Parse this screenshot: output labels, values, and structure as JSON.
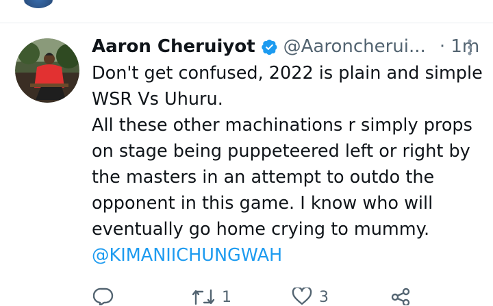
{
  "tweet": {
    "author": {
      "name": "Aaron Cheruiyot",
      "handle": "@Aaroncherui...",
      "verified_icon": "verified-badge-icon"
    },
    "time": "· 1m",
    "text_lines": [
      "Don't get confused, 2022 is plain and simple",
      "WSR Vs Uhuru.",
      "All these other machinations r simply props",
      "on stage being puppeteered left or right by",
      "the masters in an attempt to outdo the",
      "opponent in this game. I know who will",
      "eventually go home crying to mummy."
    ],
    "mention": "@KIMANIICHUNGWAH",
    "actions": {
      "reply_icon": "reply-icon",
      "retweet_count": "1",
      "like_count": "3",
      "share_icon": "share-icon"
    }
  },
  "colors": {
    "accent": "#1d9bf0",
    "secondary_text": "#536471",
    "divider": "#e6ecf0"
  }
}
